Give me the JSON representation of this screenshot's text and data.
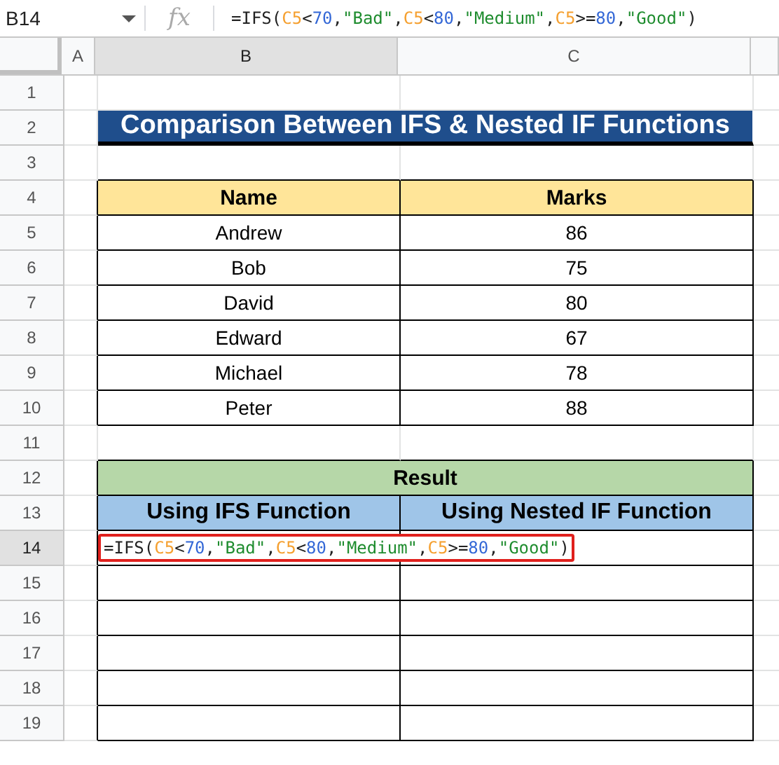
{
  "name_box": "B14",
  "function_icon": "fx",
  "formula_bar": [
    {
      "kind": "text",
      "text": "=IFS("
    },
    {
      "kind": "ref",
      "text": "C5"
    },
    {
      "kind": "text",
      "text": "<"
    },
    {
      "kind": "number",
      "text": "70"
    },
    {
      "kind": "text",
      "text": ","
    },
    {
      "kind": "string",
      "text": "\"Bad\""
    },
    {
      "kind": "text",
      "text": ","
    },
    {
      "kind": "ref",
      "text": "C5"
    },
    {
      "kind": "text",
      "text": "<"
    },
    {
      "kind": "number",
      "text": "80"
    },
    {
      "kind": "text",
      "text": ","
    },
    {
      "kind": "string",
      "text": "\"Medium\""
    },
    {
      "kind": "text",
      "text": ","
    },
    {
      "kind": "ref",
      "text": "C5"
    },
    {
      "kind": "text",
      "text": ">="
    },
    {
      "kind": "number",
      "text": "80"
    },
    {
      "kind": "text",
      "text": ","
    },
    {
      "kind": "string",
      "text": "\"Good\""
    },
    {
      "kind": "text",
      "text": ")"
    }
  ],
  "columns": [
    {
      "label": "A",
      "selected": false
    },
    {
      "label": "B",
      "selected": true
    },
    {
      "label": "C",
      "selected": false
    }
  ],
  "rows": [
    {
      "label": "1",
      "selected": false
    },
    {
      "label": "2",
      "selected": false
    },
    {
      "label": "3",
      "selected": false
    },
    {
      "label": "4",
      "selected": false
    },
    {
      "label": "5",
      "selected": false
    },
    {
      "label": "6",
      "selected": false
    },
    {
      "label": "7",
      "selected": false
    },
    {
      "label": "8",
      "selected": false
    },
    {
      "label": "9",
      "selected": false
    },
    {
      "label": "10",
      "selected": false
    },
    {
      "label": "11",
      "selected": false
    },
    {
      "label": "12",
      "selected": false
    },
    {
      "label": "13",
      "selected": false
    },
    {
      "label": "14",
      "selected": true
    },
    {
      "label": "15",
      "selected": false
    },
    {
      "label": "16",
      "selected": false
    },
    {
      "label": "17",
      "selected": false
    },
    {
      "label": "18",
      "selected": false
    },
    {
      "label": "19",
      "selected": false
    }
  ],
  "title": "Comparison Between IFS & Nested IF Functions",
  "marks_table": {
    "columns": [
      "Name",
      "Marks"
    ],
    "rows": [
      [
        "Andrew",
        "86"
      ],
      [
        "Bob",
        "75"
      ],
      [
        "David",
        "80"
      ],
      [
        "Edward",
        "67"
      ],
      [
        "Michael",
        "78"
      ],
      [
        "Peter",
        "88"
      ]
    ]
  },
  "result_table": {
    "title": "Result",
    "columns": [
      "Using IFS Function",
      "Using Nested IF Function"
    ],
    "formula": [
      {
        "kind": "text",
        "text": "=IFS("
      },
      {
        "kind": "ref",
        "text": "C5"
      },
      {
        "kind": "text",
        "text": "<"
      },
      {
        "kind": "number",
        "text": "70"
      },
      {
        "kind": "text",
        "text": ","
      },
      {
        "kind": "string",
        "text": "\"Bad\""
      },
      {
        "kind": "text",
        "text": ","
      },
      {
        "kind": "ref",
        "text": "C5"
      },
      {
        "kind": "text",
        "text": "<"
      },
      {
        "kind": "number",
        "text": "80"
      },
      {
        "kind": "text",
        "text": ","
      },
      {
        "kind": "string",
        "text": "\"Medium\""
      },
      {
        "kind": "text",
        "text": ","
      },
      {
        "kind": "ref",
        "text": "C5"
      },
      {
        "kind": "text",
        "text": ">="
      },
      {
        "kind": "number",
        "text": "80"
      },
      {
        "kind": "text",
        "text": ","
      },
      {
        "kind": "string",
        "text": "\"Good\""
      },
      {
        "kind": "text",
        "text": ")"
      }
    ]
  }
}
